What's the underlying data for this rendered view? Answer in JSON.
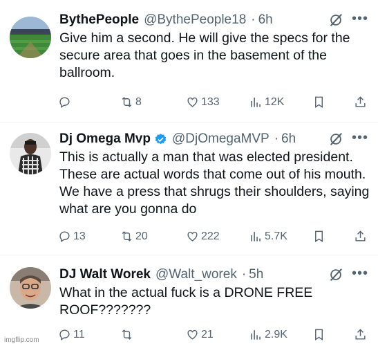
{
  "tweets": [
    {
      "name": "BythePeople",
      "handle": "@BythePeople18",
      "time": "6h",
      "verified": false,
      "text": "Give him a second. He will give the specs for the secure area that goes in the basement of the ballroom.",
      "replies": "",
      "retweets": "8",
      "likes": "133",
      "views": "12K"
    },
    {
      "name": "Dj Omega Mvp",
      "handle": "@DjOmegaMVP",
      "time": "6h",
      "verified": true,
      "text": "This is actually a man that was elected president. These are actual words that come out of his mouth. We have a press that shrugs their shoulders, saying what are you gonna do",
      "replies": "13",
      "retweets": "20",
      "likes": "222",
      "views": "5.7K"
    },
    {
      "name": "DJ Walt Worek",
      "handle": "@Walt_worek",
      "time": "5h",
      "verified": false,
      "text": "What in the actual fuck is a DRONE FREE ROOF???????",
      "replies": "11",
      "retweets": "",
      "likes": "21",
      "views": "2.9K"
    }
  ],
  "separator": "·",
  "watermark": "imgflip.com",
  "colors": {
    "text": "#0f1419",
    "secondary": "#536471",
    "verified": "#1d9bf0",
    "divider": "#eff3f4"
  },
  "icons": [
    "reply-icon",
    "retweet-icon",
    "like-icon",
    "views-icon",
    "bookmark-icon",
    "share-icon",
    "grok-icon",
    "more-icon",
    "verified-badge-icon"
  ]
}
